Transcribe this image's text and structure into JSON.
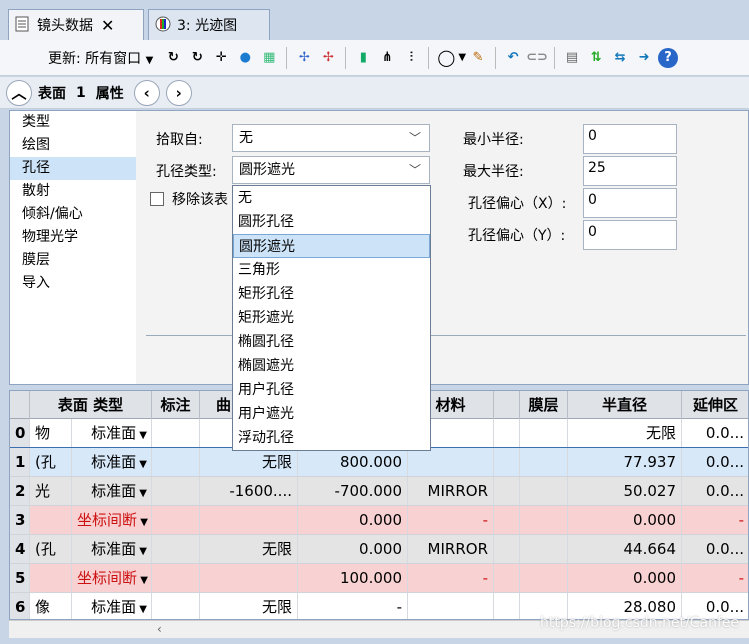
{
  "tabs": [
    {
      "label": "镜头数据",
      "active": true
    },
    {
      "label": "3: 光迹图",
      "active": false
    }
  ],
  "toolbar": {
    "update_label": "更新: 所有窗口"
  },
  "surface_bar": {
    "label": "表面",
    "surface_number": "1",
    "properties_label": "属性"
  },
  "categories": [
    "类型",
    "绘图",
    "孔径",
    "散射",
    "倾斜/偏心",
    "物理光学",
    "膜层",
    "导入"
  ],
  "selected_category": "孔径",
  "aperture": {
    "pickup_label": "拾取自:",
    "pickup_value": "无",
    "type_label": "孔径类型:",
    "type_value": "圆形遮光",
    "remove_label": "移除该表",
    "min_radius_label": "最小半径:",
    "min_radius_value": "0",
    "max_radius_label": "最大半径:",
    "max_radius_value": "25",
    "decenter_x_label": "孔径偏心（X）:",
    "decenter_x_value": "0",
    "decenter_y_label": "孔径偏心（Y）:",
    "decenter_y_value": "0"
  },
  "dropdown_options": [
    "无",
    "圆形孔径",
    "圆形遮光",
    "三角形",
    "矩形孔径",
    "矩形遮光",
    "椭圆孔径",
    "椭圆遮光",
    "用户孔径",
    "用户遮光",
    "浮动孔径"
  ],
  "dropdown_selected": "圆形遮光",
  "table": {
    "headers": [
      "表面 类型",
      "标注",
      "曲",
      "",
      "材料",
      "",
      "膜层",
      "半直径",
      "延伸区"
    ],
    "rows": [
      {
        "num": "0",
        "obj": "物",
        "type": "标准面",
        "c1": "",
        "c2": "",
        "c3": "",
        "material": "",
        "c5": "",
        "coat": "",
        "semi": "无限",
        "ext": "0.0...",
        "style": "white"
      },
      {
        "num": "1",
        "obj": "(孔",
        "type": "标准面",
        "c1": "",
        "c2": "无限",
        "c3": "800.000",
        "material": "",
        "c5": "",
        "coat": "",
        "semi": "77.937",
        "ext": "0.0...",
        "style": "sel"
      },
      {
        "num": "2",
        "obj": "光",
        "type": "标准面",
        "c1": "",
        "c2": "-1600....",
        "c3": "-700.000",
        "material": "MIRROR",
        "c5": "",
        "coat": "",
        "semi": "50.027",
        "ext": "0.0...",
        "style": "gray"
      },
      {
        "num": "3",
        "obj": "",
        "type": "坐标间断",
        "c1": "",
        "c2": "",
        "c3": "0.000",
        "material": "-",
        "c5": "",
        "coat": "",
        "semi": "0.000",
        "ext": "-",
        "style": "pink"
      },
      {
        "num": "4",
        "obj": "(孔",
        "type": "标准面",
        "c1": "",
        "c2": "无限",
        "c3": "0.000",
        "material": "MIRROR",
        "c5": "",
        "coat": "",
        "semi": "44.664",
        "ext": "0.0...",
        "style": "gray"
      },
      {
        "num": "5",
        "obj": "",
        "type": "坐标间断",
        "c1": "",
        "c2": "",
        "c3": "100.000",
        "material": "-",
        "c5": "",
        "coat": "",
        "semi": "0.000",
        "ext": "-",
        "style": "pink"
      },
      {
        "num": "6",
        "obj": "像",
        "type": "标准面",
        "c1": "",
        "c2": "无限",
        "c3": "-",
        "material": "",
        "c5": "",
        "coat": "",
        "semi": "28.080",
        "ext": "0.0...",
        "style": "white"
      }
    ]
  },
  "watermark": "https://blog.csdn.net/Canfee",
  "colors": {
    "selection": "#cde3f7",
    "coordinate_break_row": "#f8d2d2",
    "header": "#dfe3e8"
  }
}
